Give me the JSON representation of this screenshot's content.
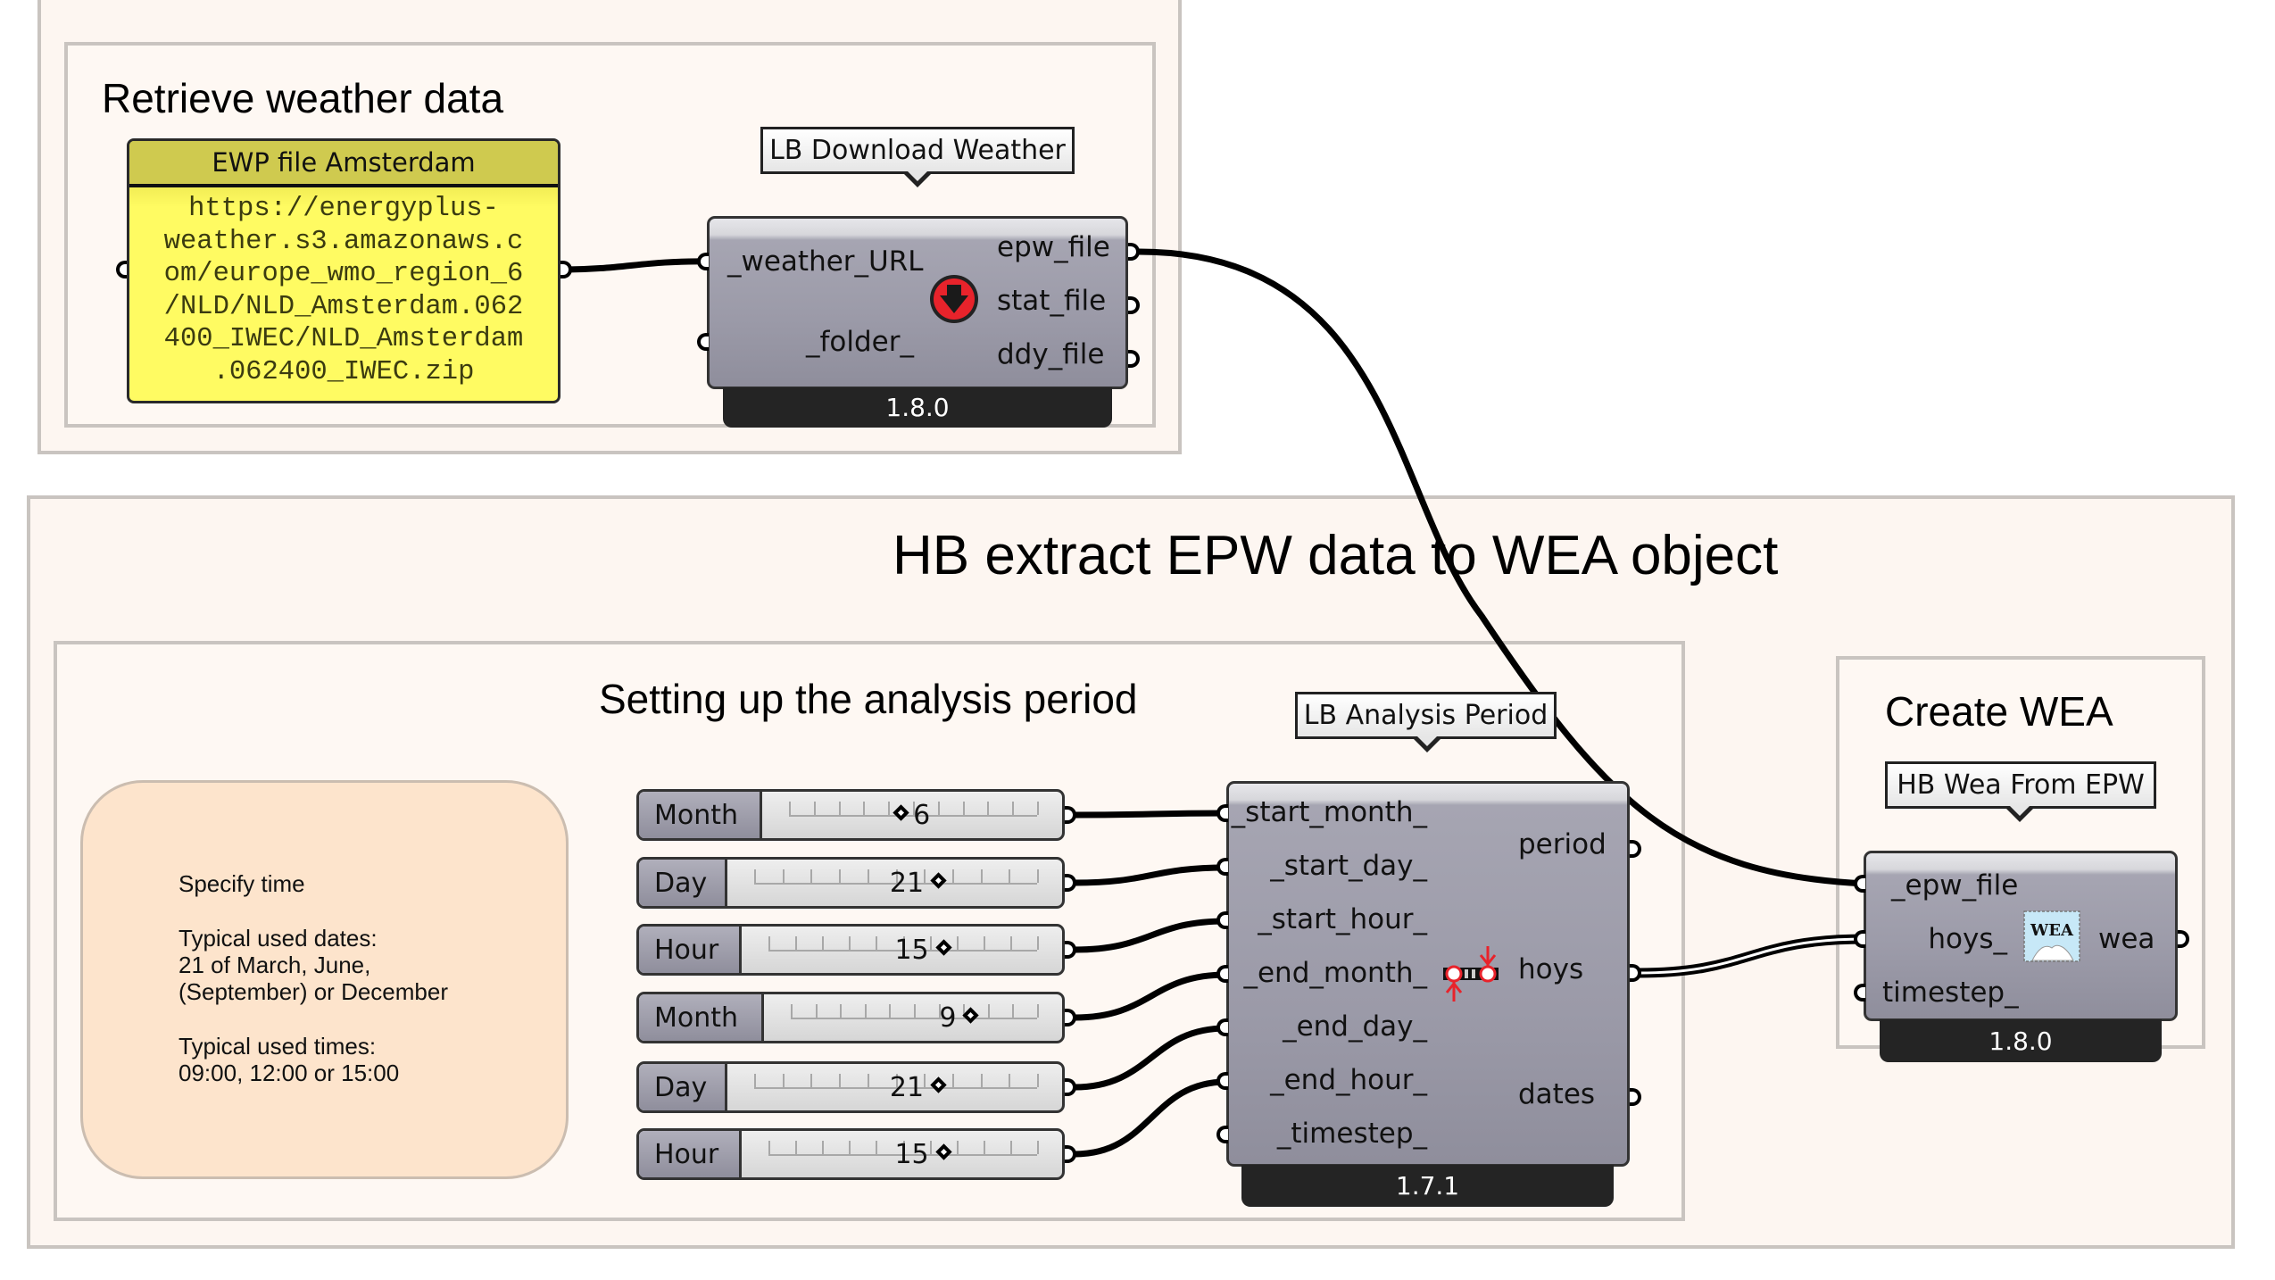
{
  "groups": {
    "retrieve": {
      "title": "Retrieve weather data"
    },
    "extract": {
      "title": "HB extract EPW data to WEA object"
    },
    "analysis": {
      "title": "Setting up the analysis period"
    },
    "create_wea": {
      "title": "Create WEA"
    }
  },
  "panel": {
    "title": "EWP file Amsterdam",
    "lines": [
      "https://energyplus-",
      "weather.s3.amazonaws.c",
      "om/europe_wmo_region_6",
      "/NLD/NLD_Amsterdam.062",
      "400_IWEC/NLD_Amsterdam",
      ".062400_IWEC.zip"
    ],
    "colors": {
      "header": "#cfca4f",
      "body": "#fffb62"
    }
  },
  "download_weather": {
    "tooltip": "LB Download Weather",
    "icon": "download-weather-icon",
    "inputs": [
      "_weather_URL",
      "_folder_"
    ],
    "outputs": [
      "epw_file",
      "stat_file",
      "ddy_file"
    ],
    "version": "1.8.0"
  },
  "analysis_period": {
    "tooltip": "LB Analysis Period",
    "icon": "analysis-period-icon",
    "inputs": [
      "_start_month_",
      "_start_day_",
      "_start_hour_",
      "_end_month_",
      "_end_day_",
      "_end_hour_",
      "_timestep_"
    ],
    "outputs": [
      "period",
      "hoys",
      "dates"
    ],
    "version": "1.7.1"
  },
  "wea_from_epw": {
    "tooltip": "HB Wea From EPW",
    "icon": "wea-icon",
    "icon_text": "WEA",
    "inputs": [
      "_epw_file",
      "hoys_",
      "timestep_"
    ],
    "outputs": [
      "wea"
    ],
    "version": "1.8.0"
  },
  "sliders": [
    {
      "label": "Month",
      "value": "6",
      "min": 1,
      "max": 12,
      "fraction": 0.45
    },
    {
      "label": "Day",
      "value": "21",
      "min": 1,
      "max": 31,
      "fraction": 0.65
    },
    {
      "label": "Hour",
      "value": "15",
      "min": 0,
      "max": 23,
      "fraction": 0.65
    },
    {
      "label": "Month",
      "value": "9",
      "min": 1,
      "max": 12,
      "fraction": 0.73
    },
    {
      "label": "Day",
      "value": "21",
      "min": 1,
      "max": 31,
      "fraction": 0.65
    },
    {
      "label": "Hour",
      "value": "15",
      "min": 0,
      "max": 23,
      "fraction": 0.65
    }
  ],
  "note": {
    "lines": [
      "Specify time",
      "",
      "Typical used dates:",
      "21 of March, June,",
      "(September) or December",
      "",
      "Typical used times:",
      "09:00, 12:00 or 15:00"
    ],
    "color": "#fde4cc"
  }
}
